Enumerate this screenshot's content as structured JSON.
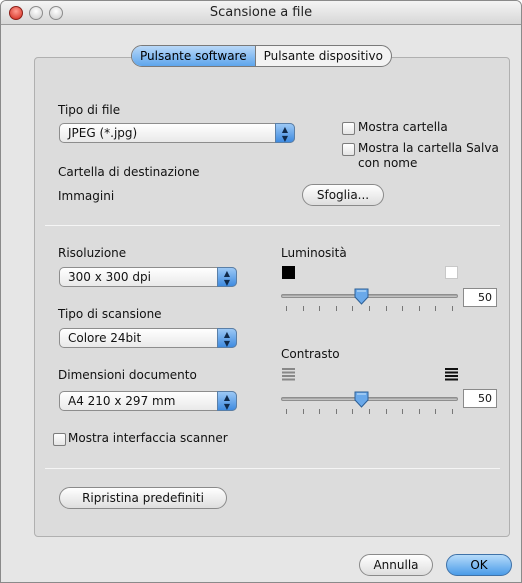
{
  "window": {
    "title": "Scansione a file"
  },
  "tabs": [
    {
      "label": "Pulsante software",
      "active": true
    },
    {
      "label": "Pulsante dispositivo",
      "active": false
    }
  ],
  "file_section": {
    "file_type_label": "Tipo di file",
    "file_type_value": "JPEG (*.jpg)",
    "show_folder_label": "Mostra cartella",
    "show_folder_checked": false,
    "show_save_as_label_line1": "Mostra la cartella Salva",
    "show_save_as_label_line2": "con nome",
    "show_save_as_checked": false,
    "destination_label": "Cartella di destinazione",
    "destination_value": "Immagini",
    "browse_button": "Sfoglia..."
  },
  "scan_section": {
    "resolution_label": "Risoluzione",
    "resolution_value": "300 x 300 dpi",
    "scan_type_label": "Tipo di scansione",
    "scan_type_value": "Colore 24bit",
    "document_size_label": "Dimensioni documento",
    "document_size_value": "A4  210 x 297 mm",
    "show_scanner_interface_label": "Mostra interfaccia scanner",
    "show_scanner_interface_checked": false,
    "brightness_label": "Luminosità",
    "brightness_value": "50",
    "brightness_fraction": 0.5,
    "contrast_label": "Contrasto",
    "contrast_value": "50",
    "contrast_fraction": 0.5
  },
  "reset_button": "Ripristina predefiniti",
  "footer": {
    "cancel_button": "Annulla",
    "ok_button": "OK"
  },
  "colors": {
    "accent_blue": "#4a9be8",
    "panel_gray": "#dcdcdc",
    "window_gray": "#e6e6e6"
  }
}
